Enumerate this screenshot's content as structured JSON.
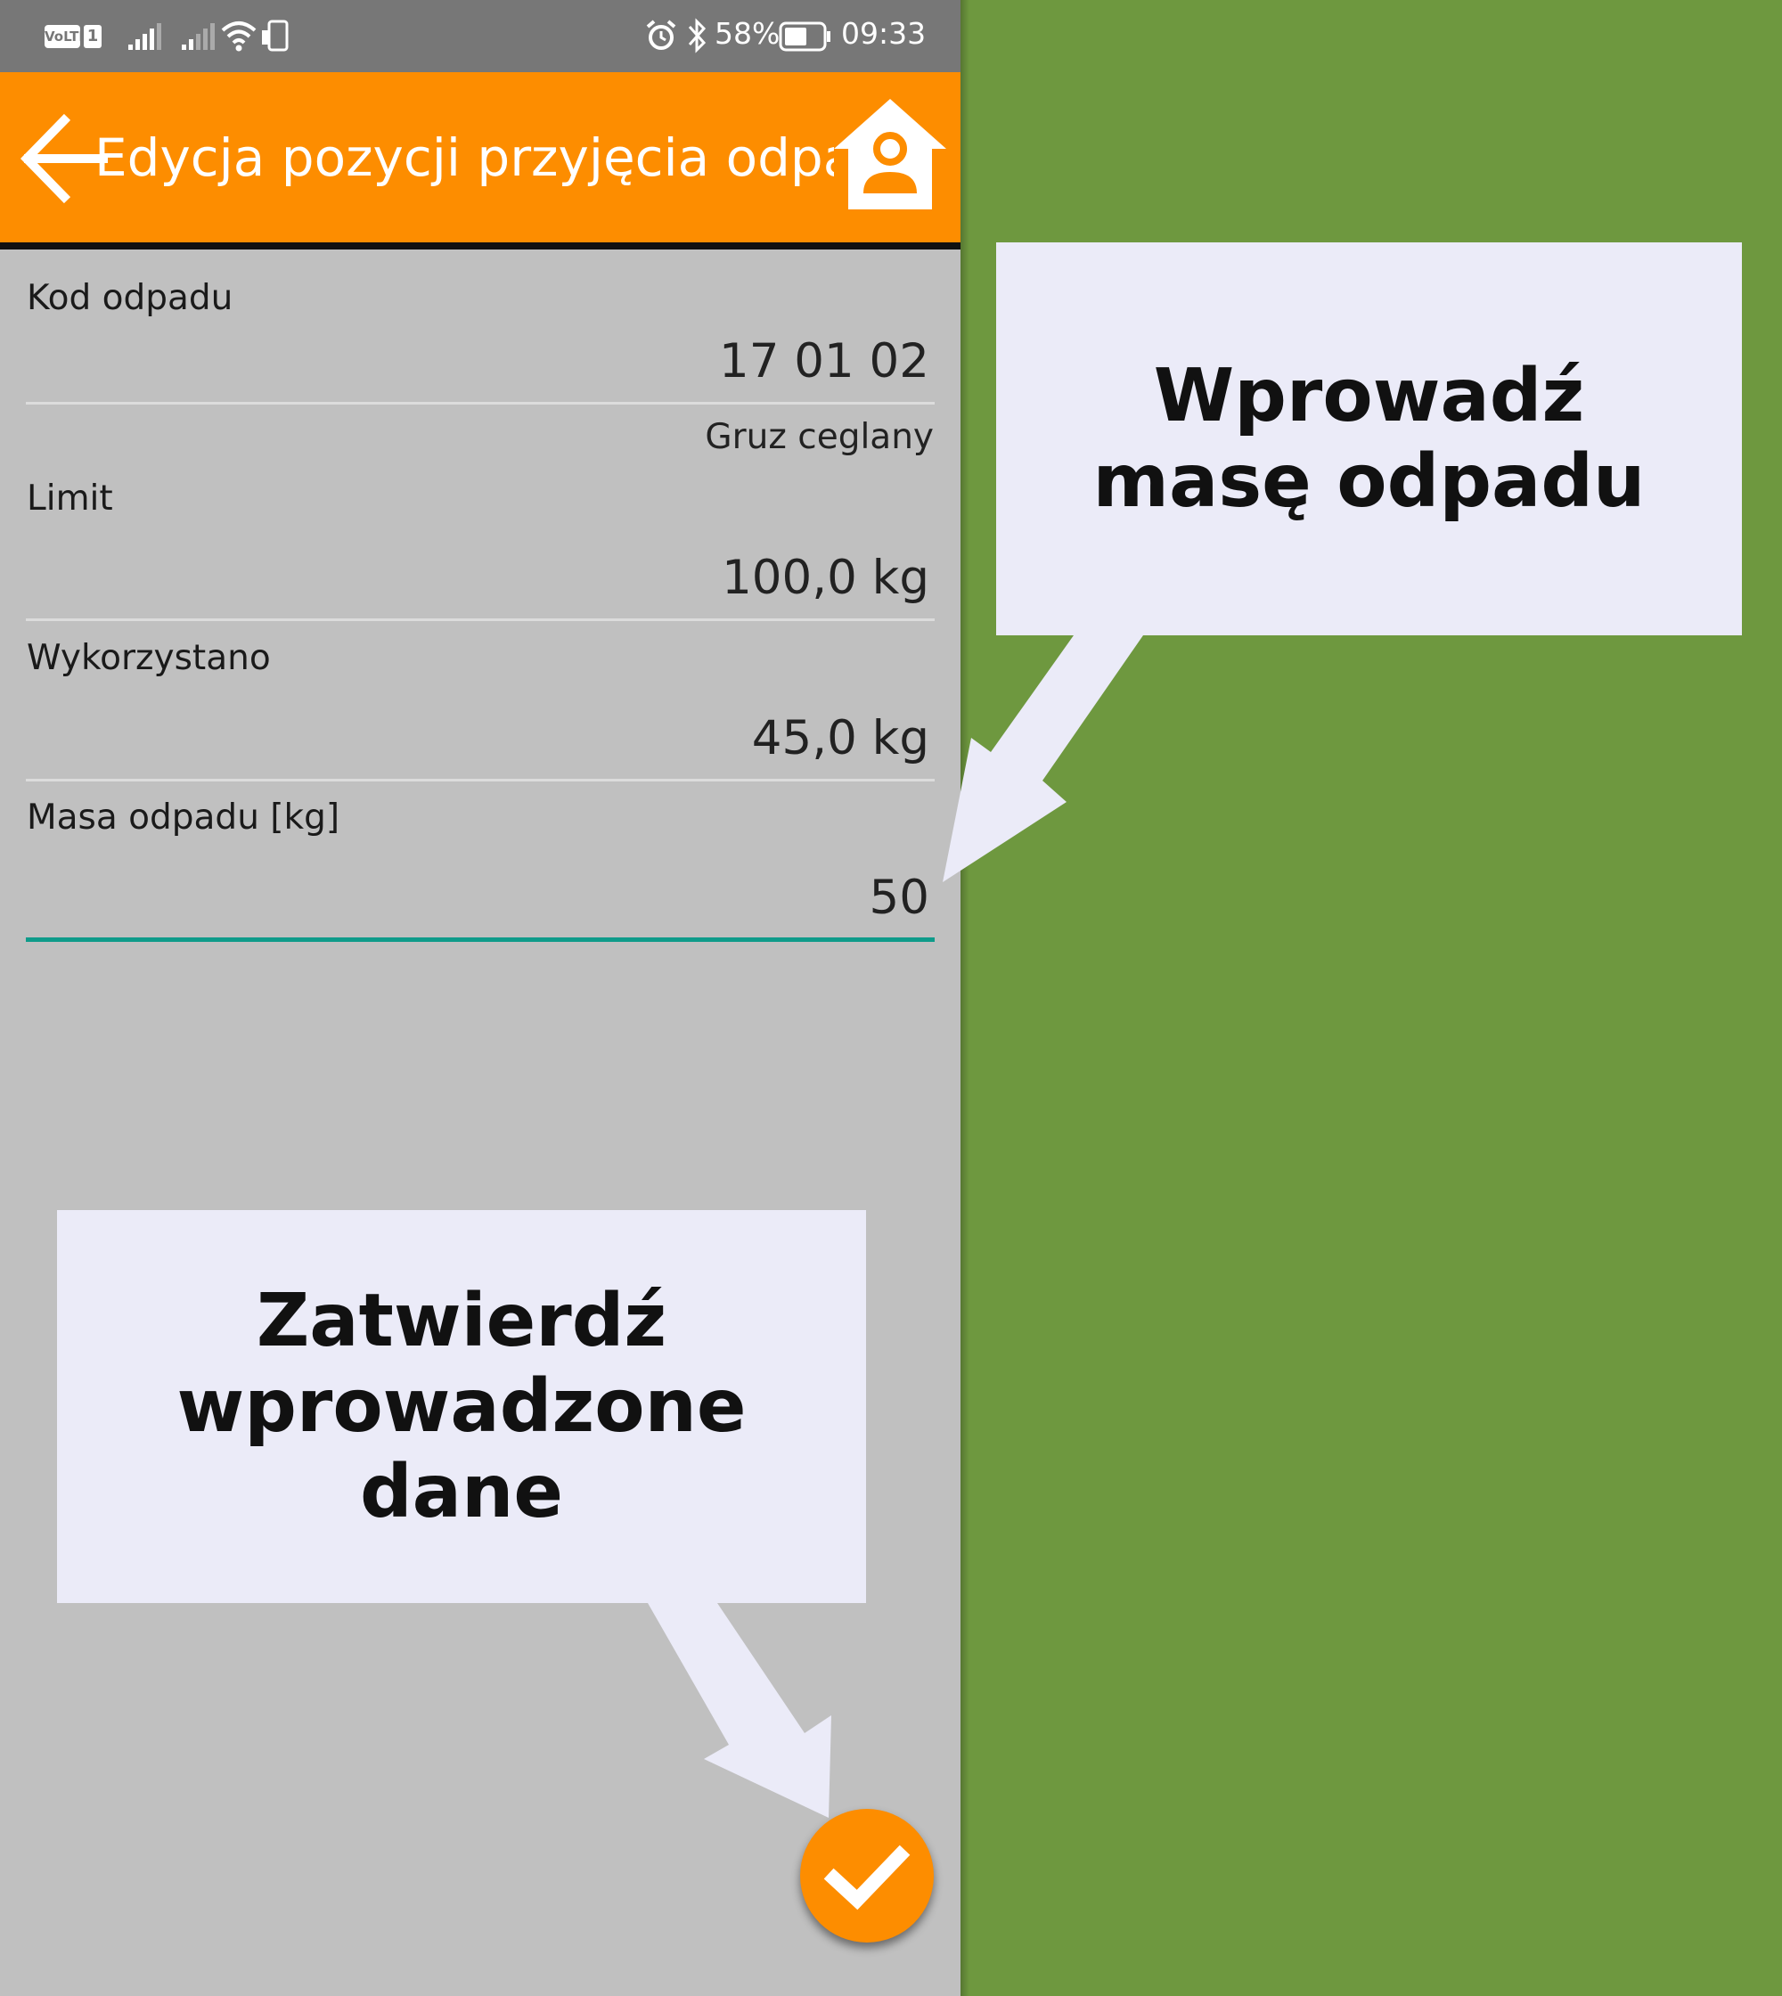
{
  "status_bar": {
    "volte": "VoLTE",
    "sim": "1",
    "battery": "58%",
    "time": "09:33",
    "icons": [
      "volte-icon",
      "signal-icon",
      "signal-icon",
      "wifi-icon",
      "phone-icon",
      "alarm-icon",
      "bluetooth-icon",
      "battery-icon"
    ]
  },
  "app_bar": {
    "title": "Edycja pozycji przyjęcia odpadu",
    "back_icon": "arrow-left-icon",
    "home_icon": "home-user-icon"
  },
  "form": {
    "kod": {
      "label": "Kod odpadu",
      "value": "17 01 02",
      "description": "Gruz ceglany"
    },
    "limit": {
      "label": "Limit",
      "value": "100,0 kg"
    },
    "used": {
      "label": "Wykorzystano",
      "value": "45,0 kg"
    },
    "mass": {
      "label": "Masa odpadu [kg]",
      "value": "50"
    }
  },
  "fab": {
    "icon": "checkmark-icon"
  },
  "callouts": {
    "mass": "Wprowadź masę odpadu",
    "confirm": "Zatwierdź wprowadzone dane"
  },
  "colors": {
    "appbar": "#fd8d00",
    "statusbar": "#777777",
    "background": "#6e983f",
    "screen": "#c0c0c0",
    "input_active": "#0e9b8a",
    "callout": "#ebebf8"
  }
}
